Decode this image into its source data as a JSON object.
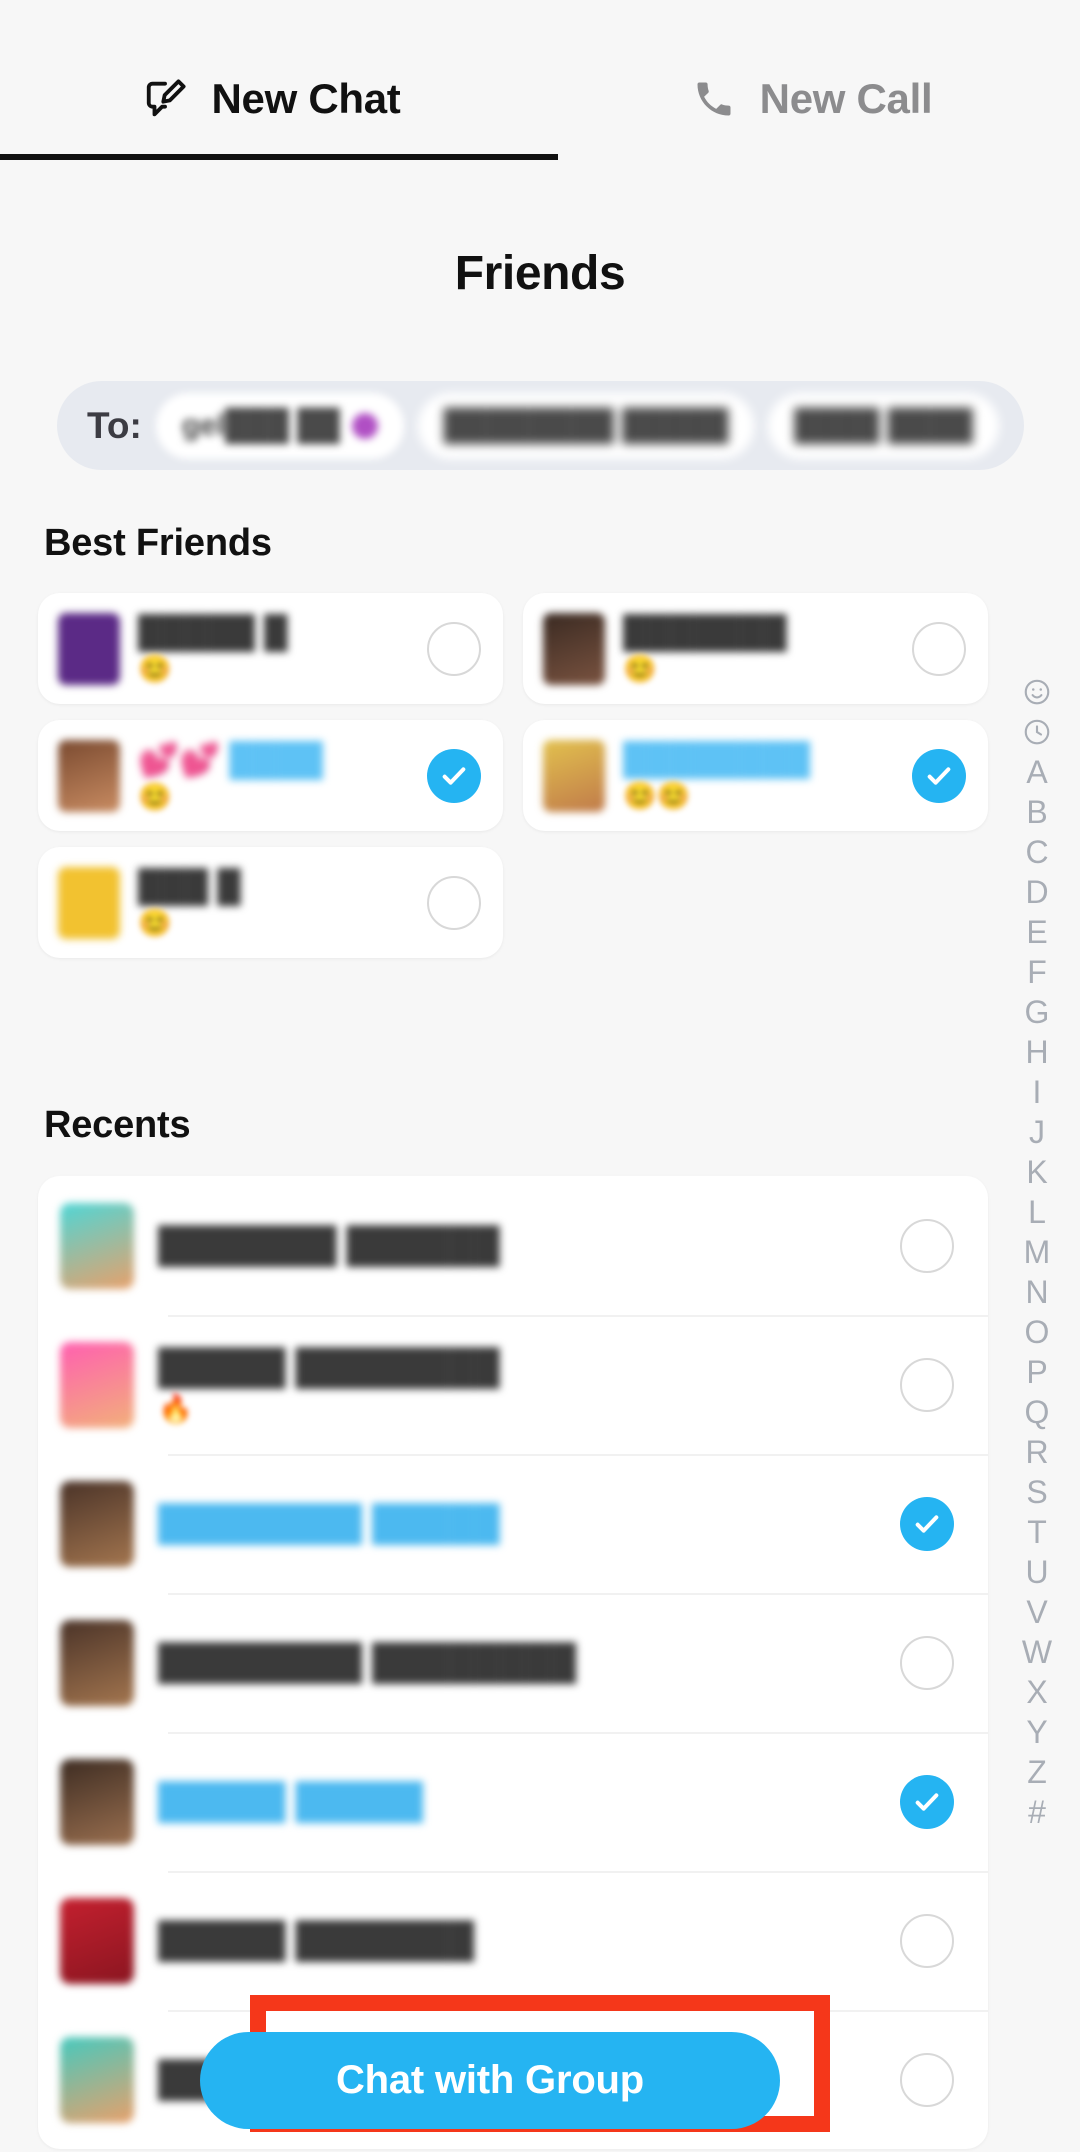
{
  "window": {
    "drag_handle": "drag-handle"
  },
  "tabs": [
    {
      "label": "New Chat",
      "icon": "chat-pencil-icon",
      "active": true
    },
    {
      "label": "New Call",
      "icon": "phone-icon",
      "active": false
    }
  ],
  "header": {
    "title": "Friends"
  },
  "recipients": {
    "label": "To:",
    "chips": [
      {
        "text": "gel███ ██",
        "has_dot": true,
        "dot_color": "#b04fc4"
      },
      {
        "text": "████████ █████",
        "has_dot": false
      },
      {
        "text": "████ ████",
        "has_dot": false
      }
    ]
  },
  "best_friends": {
    "title": "Best Friends",
    "items": [
      {
        "name": "█████ █",
        "emoji": "😊",
        "avatar_color": "#5b2a86",
        "selected": false
      },
      {
        "name": "███████",
        "emoji": "😊",
        "avatar_color": "#4a3228",
        "selected": false
      },
      {
        "name": "💕💕 ████",
        "emoji": "😊",
        "avatar_color": "#8a5a3c",
        "selected": true
      },
      {
        "name": "████████",
        "emoji": "😊😊",
        "avatar_color": "#c8a84b",
        "selected": true
      },
      {
        "name": "███ █",
        "emoji": "😊",
        "avatar_color": "#f2c230",
        "selected": false
      }
    ]
  },
  "recents": {
    "title": "Recents",
    "items": [
      {
        "name": "███████ ██████",
        "emoji": "",
        "avatar_color": "#45c4c4",
        "selected": false
      },
      {
        "name": "█████ ████████",
        "emoji": "🔥",
        "avatar_color": "#f255a8",
        "selected": false
      },
      {
        "name": "████████ █████",
        "emoji": "",
        "avatar_color": "#6b4a3a",
        "selected": true
      },
      {
        "name": "████████ ████████",
        "emoji": "",
        "avatar_color": "#6b4a3a",
        "selected": false
      },
      {
        "name": "█████ █████",
        "emoji": "",
        "avatar_color": "#5a4032",
        "selected": true
      },
      {
        "name": "█████ ███████",
        "emoji": "",
        "avatar_color": "#b01f2e",
        "selected": false
      },
      {
        "name": "████",
        "emoji": "",
        "avatar_color": "#3fb9b0",
        "selected": false
      }
    ]
  },
  "alphabet_index": [
    {
      "label": "☺",
      "icon": "smiley-icon"
    },
    {
      "label": "◷",
      "icon": "clock-icon"
    },
    {
      "label": "A"
    },
    {
      "label": "B"
    },
    {
      "label": "C"
    },
    {
      "label": "D"
    },
    {
      "label": "E"
    },
    {
      "label": "F"
    },
    {
      "label": "G"
    },
    {
      "label": "H"
    },
    {
      "label": "I"
    },
    {
      "label": "J"
    },
    {
      "label": "K"
    },
    {
      "label": "L"
    },
    {
      "label": "M"
    },
    {
      "label": "N"
    },
    {
      "label": "O"
    },
    {
      "label": "P"
    },
    {
      "label": "Q"
    },
    {
      "label": "R"
    },
    {
      "label": "S"
    },
    {
      "label": "T"
    },
    {
      "label": "U"
    },
    {
      "label": "V"
    },
    {
      "label": "W"
    },
    {
      "label": "X"
    },
    {
      "label": "Y"
    },
    {
      "label": "Z"
    },
    {
      "label": "#"
    }
  ],
  "cta": {
    "label": "Chat with Group",
    "color": "#25b4f2",
    "annotation_color": "#f5371a"
  },
  "colors": {
    "accent": "#25b4f2",
    "selected_text": "#4cb9f0",
    "background": "#f7f7f7",
    "card": "#ffffff"
  }
}
